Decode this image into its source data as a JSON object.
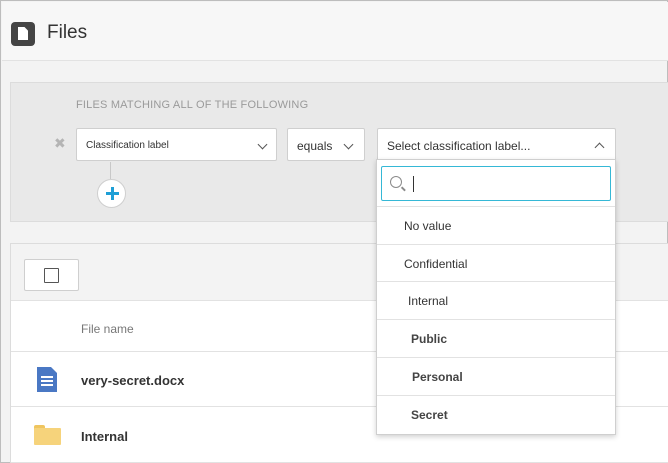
{
  "header": {
    "title": "Files",
    "icon": "file-icon"
  },
  "filter": {
    "heading": "FILES MATCHING ALL OF THE FOLLOWING",
    "field_value": "Classification label",
    "operator_value": "equals",
    "value_placeholder": "Select classification label..."
  },
  "dropdown": {
    "search_value": "",
    "options": [
      {
        "label": "No value",
        "bold": false
      },
      {
        "label": "Confidential",
        "bold": false
      },
      {
        "label": "Internal",
        "bold": false
      },
      {
        "label": "Public",
        "bold": true
      },
      {
        "label": "Personal",
        "bold": true
      },
      {
        "label": "Secret",
        "bold": true
      }
    ]
  },
  "files": {
    "column_name": "File name",
    "rows": [
      {
        "name": "very-secret.docx",
        "icon": "word-document-icon"
      },
      {
        "name": "Internal",
        "icon": "folder-icon"
      }
    ]
  },
  "colors": {
    "accent": "#1e9fd6",
    "search_focus": "#35b8d6",
    "doc_blue": "#4a78c4",
    "folder": "#f6d37b"
  }
}
